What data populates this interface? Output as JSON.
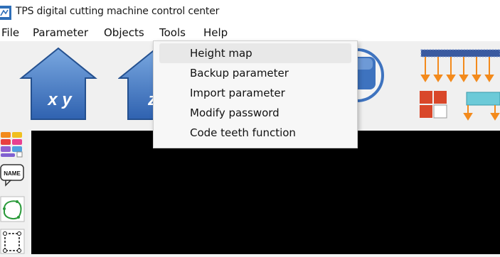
{
  "window": {
    "title": "TPS digital cutting machine control center"
  },
  "menubar": [
    {
      "label": "File"
    },
    {
      "label": "Parameter"
    },
    {
      "label": "Objects"
    },
    {
      "label": "Tools"
    },
    {
      "label": "Help"
    }
  ],
  "toolbar": {
    "home_xy_label": "x y",
    "home_z_label": "z"
  },
  "tools_menu": {
    "items": [
      {
        "label": "Height map"
      },
      {
        "label": "Backup parameter"
      },
      {
        "label": "Import parameter"
      },
      {
        "label": "Modify password"
      },
      {
        "label": "Code teeth function"
      }
    ]
  },
  "sidebar": {
    "name_tool_label": "NAME"
  },
  "colors": {
    "house_blue": "#3f74c0",
    "orange": "#f38a1c",
    "red": "#d9472a",
    "cyan": "#6ccad8",
    "canvas": "#000000"
  }
}
